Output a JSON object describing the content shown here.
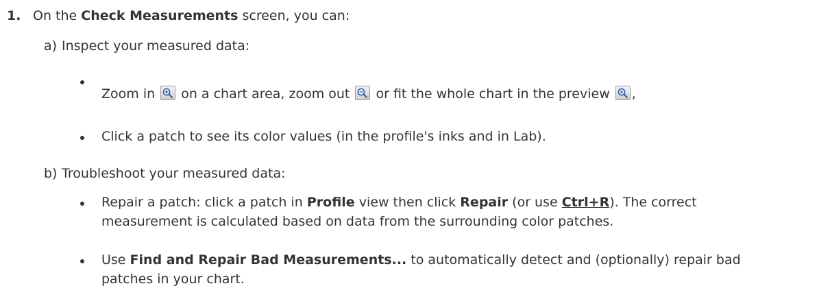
{
  "step": {
    "number": "1.",
    "text_before": "On the ",
    "screen_name": "Check Measurements",
    "text_after": " screen, you can:"
  },
  "sub_a": {
    "label": "a)",
    "text": "Inspect your measured data:",
    "bullets": {
      "zoom": {
        "part1": "Zoom in ",
        "part2": " on a chart area, zoom out ",
        "part3": " or fit the whole chart in the preview ",
        "part4": ","
      },
      "click": {
        "text": "Click a patch to see its color values (in the profile's inks and in Lab)."
      }
    }
  },
  "sub_b": {
    "label": "b)",
    "text": "Troubleshoot your measured data:",
    "bullets": {
      "repair": {
        "part1": "Repair a patch: click a patch in ",
        "profile": "Profile",
        "part2": " view then click ",
        "repair": "Repair",
        "part3": " (or use ",
        "shortcut": "Ctrl+R",
        "part4": "). The correct",
        "line2": "measurement is calculated based on data from the surrounding color patches."
      },
      "find": {
        "part1": "Use ",
        "feature": "Find and Repair Bad Measurements...",
        "part2": " to automatically detect and (optionally) repair bad",
        "line2": "patches in your chart."
      }
    }
  },
  "icons": {
    "zoom_in": "zoom-in-icon",
    "zoom_out": "zoom-out-icon",
    "zoom_fit": "zoom-fit-icon"
  },
  "colors": {
    "text": "#333333",
    "icon_lens": "#2e5f9e"
  }
}
